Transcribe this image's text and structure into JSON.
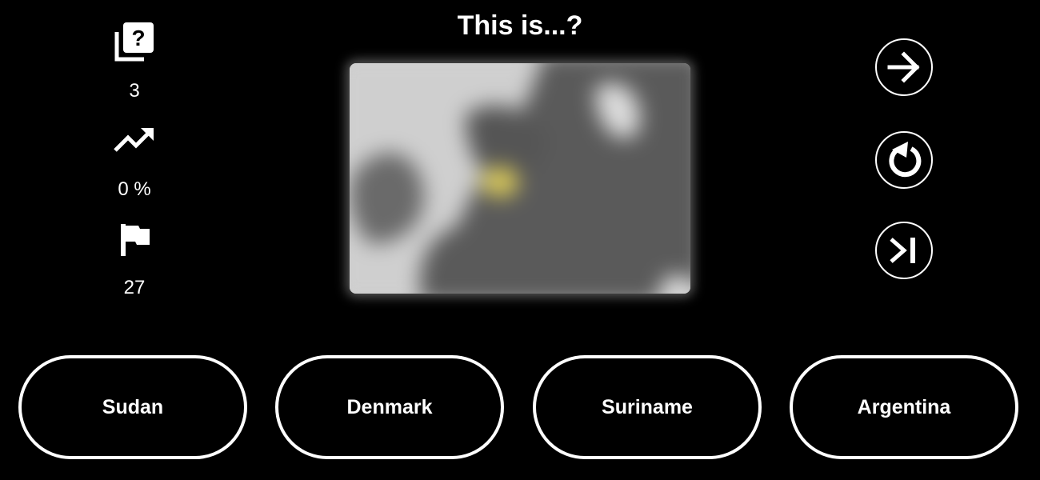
{
  "quiz": {
    "title": "This is...?"
  },
  "stats": {
    "questions_icon": "question-cards-icon",
    "questions_count": "3",
    "accuracy_icon": "trending-up-icon",
    "accuracy_value": "0 %",
    "flags_icon": "flag-icon",
    "remaining_count": "27"
  },
  "controls": {
    "next_icon": "arrow-right-icon",
    "restart_icon": "refresh-icon",
    "skip_icon": "skip-to-end-icon"
  },
  "map": {
    "highlight_color": "#d8c85a",
    "land_color": "#5a5a5a",
    "sea_color": "#cfcfcf"
  },
  "answers": [
    "Sudan",
    "Denmark",
    "Suriname",
    "Argentina"
  ]
}
